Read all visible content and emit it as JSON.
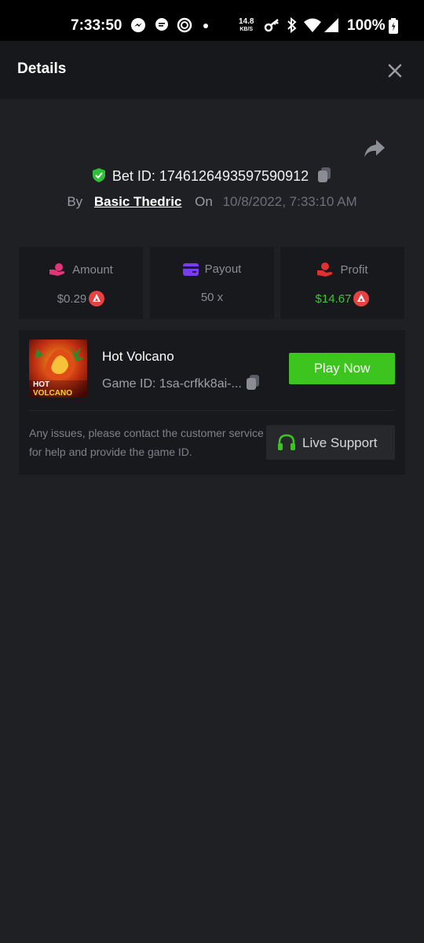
{
  "status_bar": {
    "time": "7:33:50",
    "net_speed": "14.8",
    "net_unit": "KB/S",
    "battery": "100%",
    "icons": [
      "messenger-icon",
      "chat-icon",
      "target-icon",
      "dot-icon",
      "key-icon",
      "bluetooth-icon",
      "wifi-icon",
      "signal-icon",
      "battery-icon"
    ]
  },
  "header": {
    "title": "Details",
    "close_icon": "close-icon"
  },
  "bet": {
    "id_label": "Bet ID: 1746126493597590912",
    "by_label": "By",
    "user": "Basic Thedric",
    "on_label": "On",
    "date": "10/8/2022, 7:33:10 AM"
  },
  "stats": {
    "amount": {
      "label": "Amount",
      "value": "$0.29"
    },
    "payout": {
      "label": "Payout",
      "value": "50 x"
    },
    "profit": {
      "label": "Profit",
      "value": "$14.67"
    }
  },
  "game": {
    "name": "Hot Volcano",
    "id_label": "Game ID: 1sa-crfkk8ai-...",
    "thumb_text_line1": "HOT",
    "thumb_text_line2": "VOLCANO",
    "play_label": "Play Now"
  },
  "help": {
    "text": "Any issues, please contact the customer service for help and provide the game ID.",
    "support_label": "Live Support"
  },
  "colors": {
    "accent_green": "#3ec41f",
    "profit_green": "#3ec43a",
    "amount_pink": "#e0357a",
    "payout_purple": "#7a3cf0",
    "profit_red": "#e03030",
    "coin_red": "#e84142"
  }
}
